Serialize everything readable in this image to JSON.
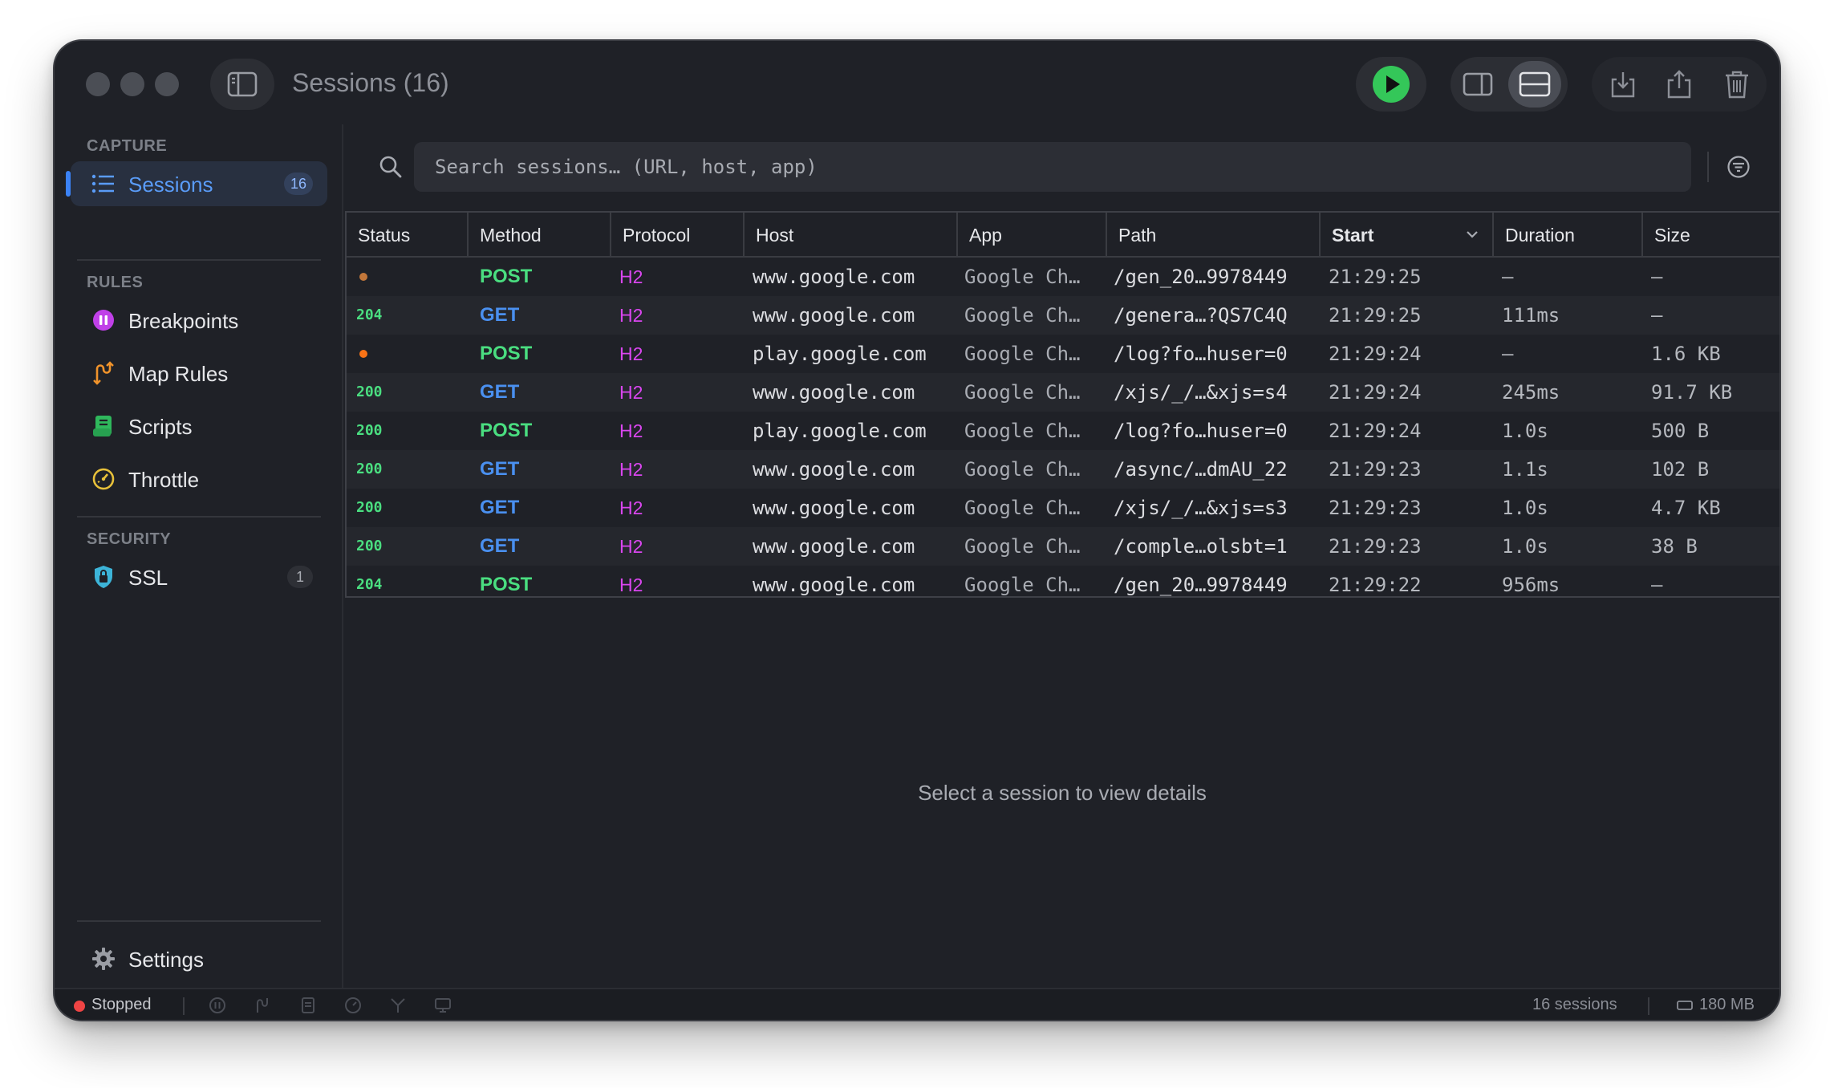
{
  "titlebar": {
    "title": "Sessions (16)"
  },
  "sidebar": {
    "capture_label": "CAPTURE",
    "rules_label": "RULES",
    "security_label": "SECURITY",
    "items": [
      {
        "label": "Sessions",
        "badge": "16",
        "icon": "list-icon",
        "active": true
      },
      {
        "label": "Breakpoints",
        "icon": "pause-circle-icon"
      },
      {
        "label": "Map Rules",
        "icon": "map-rules-icon"
      },
      {
        "label": "Scripts",
        "icon": "script-icon"
      },
      {
        "label": "Throttle",
        "icon": "speedometer-icon"
      },
      {
        "label": "SSL",
        "badge": "1",
        "icon": "lock-shield-icon"
      }
    ],
    "settings_label": "Settings"
  },
  "search": {
    "placeholder": "Search sessions… (URL, host, app)"
  },
  "table": {
    "columns": [
      "Status",
      "Method",
      "Protocol",
      "Host",
      "App",
      "Path",
      "Start",
      "Duration",
      "Size"
    ],
    "sorted_column": "Start",
    "rows": [
      {
        "status": "",
        "pending": true,
        "method": "POST",
        "protocol": "H2",
        "host": "www.google.com",
        "app": "Google Ch…",
        "path": "/gen_20…9978449",
        "start": "21:29:25",
        "duration": "–",
        "size": "–"
      },
      {
        "status": "204",
        "method": "GET",
        "protocol": "H2",
        "host": "www.google.com",
        "app": "Google Ch…",
        "path": "/genera…?QS7C4Q",
        "start": "21:29:25",
        "duration": "111ms",
        "size": "–"
      },
      {
        "status": "",
        "pending": true,
        "method": "POST",
        "protocol": "H2",
        "host": "play.google.com",
        "app": "Google Ch…",
        "path": "/log?fo…huser=0",
        "start": "21:29:24",
        "duration": "–",
        "size": "1.6 KB"
      },
      {
        "status": "200",
        "method": "GET",
        "protocol": "H2",
        "host": "www.google.com",
        "app": "Google Ch…",
        "path": "/xjs/_/…&xjs=s4",
        "start": "21:29:24",
        "duration": "245ms",
        "size": "91.7 KB"
      },
      {
        "status": "200",
        "method": "POST",
        "protocol": "H2",
        "host": "play.google.com",
        "app": "Google Ch…",
        "path": "/log?fo…huser=0",
        "start": "21:29:24",
        "duration": "1.0s",
        "size": "500 B"
      },
      {
        "status": "200",
        "method": "GET",
        "protocol": "H2",
        "host": "www.google.com",
        "app": "Google Ch…",
        "path": "/async/…dmAU_22",
        "start": "21:29:23",
        "duration": "1.1s",
        "size": "102 B"
      },
      {
        "status": "200",
        "method": "GET",
        "protocol": "H2",
        "host": "www.google.com",
        "app": "Google Ch…",
        "path": "/xjs/_/…&xjs=s3",
        "start": "21:29:23",
        "duration": "1.0s",
        "size": "4.7 KB"
      },
      {
        "status": "200",
        "method": "GET",
        "protocol": "H2",
        "host": "www.google.com",
        "app": "Google Ch…",
        "path": "/comple…olsbt=1",
        "start": "21:29:23",
        "duration": "1.0s",
        "size": "38 B"
      },
      {
        "status": "204",
        "method": "POST",
        "protocol": "H2",
        "host": "www.google.com",
        "app": "Google Ch…",
        "path": "/gen_20…9978449",
        "start": "21:29:22",
        "duration": "956ms",
        "size": "–"
      }
    ]
  },
  "detail": {
    "empty_message": "Select a session to view details"
  },
  "statusbar": {
    "state": "Stopped",
    "session_count": "16 sessions",
    "memory": "180 MB"
  },
  "colors": {
    "accent": "#3b82f6",
    "get": "#4a90f0",
    "post": "#4ade80",
    "protocol": "#d946ef",
    "status_ok": "#4ade80",
    "pending": "#f97316",
    "stopped": "#ef4444"
  }
}
